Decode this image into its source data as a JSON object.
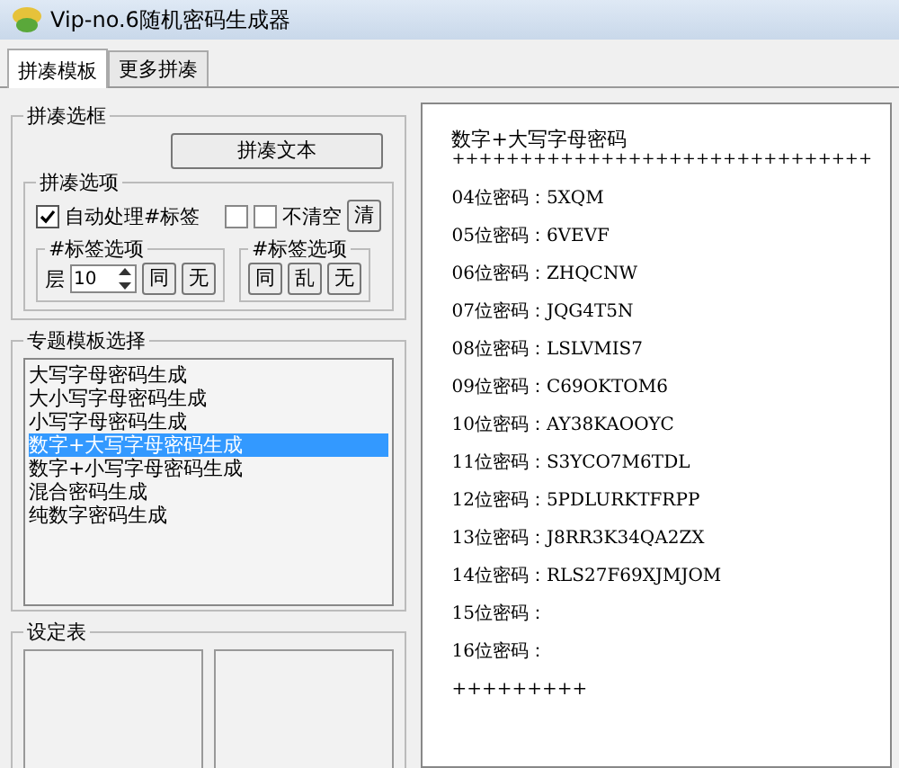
{
  "window": {
    "title": "Vip-no.6随机密码生成器"
  },
  "tabs": [
    {
      "label": "拼凑模板",
      "selected": true
    },
    {
      "label": "更多拼凑",
      "selected": false
    }
  ],
  "compose_group": {
    "title": "拼凑选框",
    "button": "拼凑文本",
    "options": {
      "title": "拼凑选项",
      "auto_tag": {
        "label": "自动处理#标签",
        "checked": true
      },
      "checkboxes": [
        {
          "checked": false
        },
        {
          "label": "不清空",
          "checked": false
        }
      ],
      "clear_button": "清",
      "tag_left": {
        "title": "#标签选项",
        "layer_label": "层",
        "layer_value": "10",
        "buttons": [
          "同",
          "无"
        ]
      },
      "tag_right": {
        "title": "#标签选项",
        "buttons": [
          "同",
          "乱",
          "无"
        ]
      }
    }
  },
  "template_group": {
    "title": "专题模板选择",
    "items": [
      {
        "label": "大写字母密码生成",
        "selected": false
      },
      {
        "label": "大小写字母密码生成",
        "selected": false
      },
      {
        "label": "小写字母密码生成",
        "selected": false
      },
      {
        "label": "数字+大写字母密码生成",
        "selected": true
      },
      {
        "label": "数字+小写字母密码生成",
        "selected": false
      },
      {
        "label": "混合密码生成",
        "selected": false
      },
      {
        "label": "纯数字密码生成",
        "selected": false
      }
    ]
  },
  "settings_group": {
    "title": "设定表"
  },
  "output": {
    "heading": "数字+大写字母密码",
    "rule": "+++++++++++++++++++++++++++++++",
    "lines": [
      "04位密码：5XQM",
      "05位密码：6VEVF",
      "06位密码：ZHQCNW",
      "07位密码：JQG4T5N",
      "08位密码：LSLVMIS7",
      "09位密码：C69OKTOM6",
      "10位密码：AY38KAOOYC",
      "11位密码：S3YCO7M6TDL",
      "12位密码：5PDLURKTFRPP",
      "13位密码：J8RR3K34QA2ZX",
      "14位密码：RLS27F69XJMJOM",
      "15位密码：",
      "16位密码："
    ],
    "footer": "+++++++++"
  }
}
